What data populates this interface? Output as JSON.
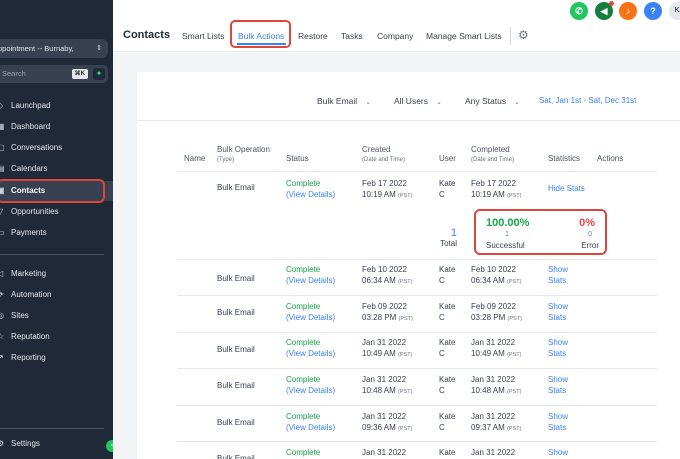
{
  "sidebar": {
    "location": "ppointment -- Burnaby,",
    "search_placeholder": "Search",
    "search_shortcut": "⌘K",
    "items": [
      {
        "label": "Launchpad",
        "icon": "rocket-icon"
      },
      {
        "label": "Dashboard",
        "icon": "dashboard-icon"
      },
      {
        "label": "Conversations",
        "icon": "chat-icon"
      },
      {
        "label": "Calendars",
        "icon": "calendar-icon"
      },
      {
        "label": "Contacts",
        "icon": "contacts-icon"
      },
      {
        "label": "Opportunities",
        "icon": "funnel-icon"
      },
      {
        "label": "Payments",
        "icon": "card-icon"
      },
      {
        "label": "Marketing",
        "icon": "megaphone-icon"
      },
      {
        "label": "Automation",
        "icon": "automation-icon"
      },
      {
        "label": "Sites",
        "icon": "globe-icon"
      },
      {
        "label": "Reputation",
        "icon": "star-icon"
      },
      {
        "label": "Reporting",
        "icon": "chart-icon"
      },
      {
        "label": "Settings",
        "icon": "gear-icon"
      }
    ]
  },
  "header": {
    "title": "Contacts",
    "tabs": [
      "Smart Lists",
      "Bulk Actions",
      "Restore",
      "Tasks",
      "Company",
      "Manage Smart Lists"
    ],
    "avatar_initials": "KI",
    "help": "?"
  },
  "filters": {
    "operation": "Bulk Email",
    "users": "All Users",
    "status": "Any Status",
    "date_range": "Sat, Jan 1st - Sat, Dec 31st"
  },
  "table": {
    "headers": {
      "name": "Name",
      "operation": "Bulk Operation",
      "operation_sub": "(Type)",
      "status": "Status",
      "created": "Created",
      "created_sub": "(Date and Time)",
      "user": "User",
      "completed": "Completed",
      "completed_sub": "(Date and Time)",
      "statistics": "Statistics",
      "actions": "Actions"
    },
    "rows": [
      {
        "type": "Bulk Email",
        "status": "Complete",
        "details": "(View Details)",
        "created_date": "Feb 17 2022",
        "created_time": "10:19 AM",
        "user1": "Kate",
        "user2": "C",
        "completed_date": "Feb 17 2022",
        "completed_time": "10:19 AM",
        "stats1": "Hide Stats",
        "stats2": ""
      },
      {
        "type": "Bulk Email",
        "status": "Complete",
        "details": "(View Details)",
        "created_date": "Feb 10 2022",
        "created_time": "06:34 AM",
        "user1": "Kate",
        "user2": "C",
        "completed_date": "Feb 10 2022",
        "completed_time": "06:34 AM",
        "stats1": "Show",
        "stats2": "Stats"
      },
      {
        "type": "Bulk Email",
        "status": "Complete",
        "details": "(View Details)",
        "created_date": "Feb 09 2022",
        "created_time": "03:28 PM",
        "user1": "Kate",
        "user2": "C",
        "completed_date": "Feb 09 2022",
        "completed_time": "03:28 PM",
        "stats1": "Show",
        "stats2": "Stats"
      },
      {
        "type": "Bulk Email",
        "status": "Complete",
        "details": "(View Details)",
        "created_date": "Jan 31 2022",
        "created_time": "10:49 AM",
        "user1": "Kate",
        "user2": "C",
        "completed_date": "Jan 31 2022",
        "completed_time": "10:49 AM",
        "stats1": "Show",
        "stats2": "Stats"
      },
      {
        "type": "Bulk Email",
        "status": "Complete",
        "details": "(View Details)",
        "created_date": "Jan 31 2022",
        "created_time": "10:48 AM",
        "user1": "Kate",
        "user2": "C",
        "completed_date": "Jan 31 2022",
        "completed_time": "10:48 AM",
        "stats1": "Show",
        "stats2": "Stats"
      },
      {
        "type": "Bulk Email",
        "status": "Complete",
        "details": "(View Details)",
        "created_date": "Jan 31 2022",
        "created_time": "09:36 AM",
        "user1": "Kate",
        "user2": "C",
        "completed_date": "Jan 31 2022",
        "completed_time": "09:37 AM",
        "stats1": "Show",
        "stats2": "Stats"
      },
      {
        "type": "Bulk Email",
        "status": "Complete",
        "details": "",
        "created_date": "Jan 31 2022",
        "created_time": "",
        "user1": "Kate",
        "user2": "",
        "completed_date": "Jan 31 2022",
        "completed_time": "",
        "stats1": "Show",
        "stats2": ""
      }
    ],
    "tz": "(PST)"
  },
  "summary": {
    "total_count": "1",
    "total_label": "Total",
    "success_pct": "100.00%",
    "success_count": "1",
    "success_label": "Successful",
    "error_pct": "0%",
    "error_count": "0",
    "error_label": "Error"
  },
  "colors": {
    "accent": "#3b82f6",
    "success": "#16a34a",
    "error": "#ef4444",
    "highlight": "#e0453a",
    "sidebar_bg": "#1f2937"
  }
}
